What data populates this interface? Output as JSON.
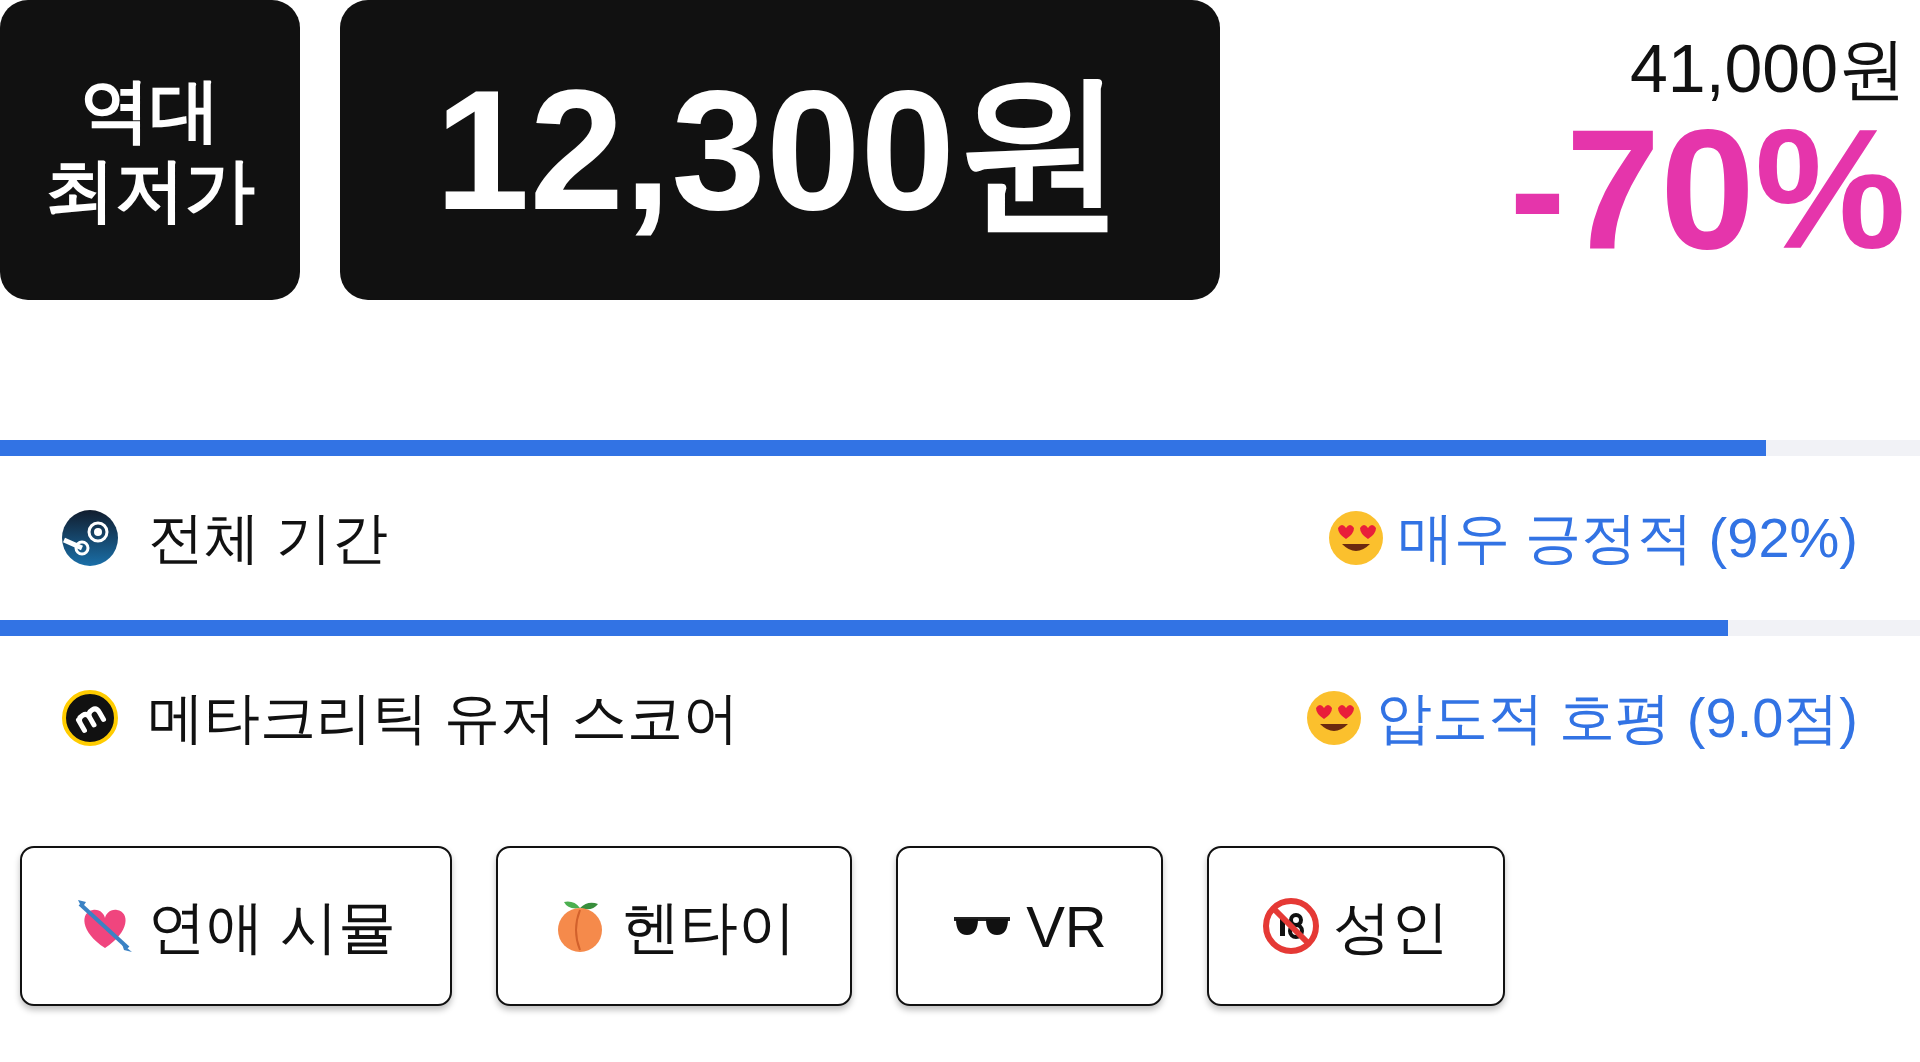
{
  "badge": {
    "label_lines": [
      "역대",
      "최저가"
    ]
  },
  "price": "12,300원",
  "original_price": "41,000원",
  "discount": "-70%",
  "reviews": [
    {
      "kind": "steam",
      "label": "전체 기간",
      "level": 0.92,
      "verdict": "매우 긍정적 (92%)"
    },
    {
      "kind": "metacritic",
      "label": "메타크리틱 유저 스코어",
      "level": 0.9,
      "verdict": "압도적 호평 (9.0점)"
    }
  ],
  "tags": [
    {
      "kind": "heart",
      "label": "연애 시뮬"
    },
    {
      "kind": "peach",
      "label": "헨타이"
    },
    {
      "kind": "sunglasses",
      "label": "VR"
    },
    {
      "kind": "adult",
      "label": "성인"
    }
  ]
}
